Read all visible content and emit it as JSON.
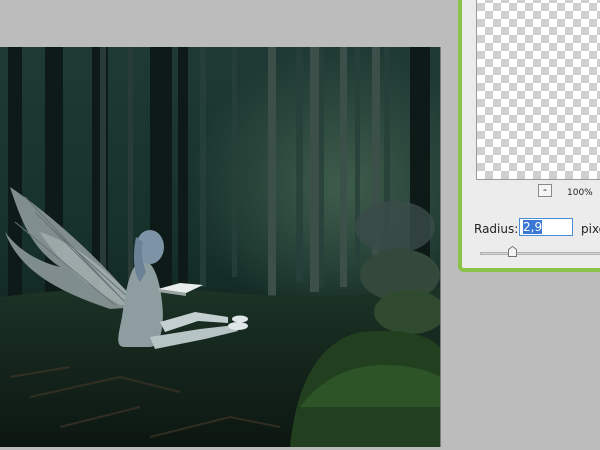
{
  "dialog": {
    "zoom_out_label": "-",
    "zoom_level": "100%",
    "radius_label": "Radius:",
    "radius_value": "2,9",
    "unit_label": "pixe"
  }
}
